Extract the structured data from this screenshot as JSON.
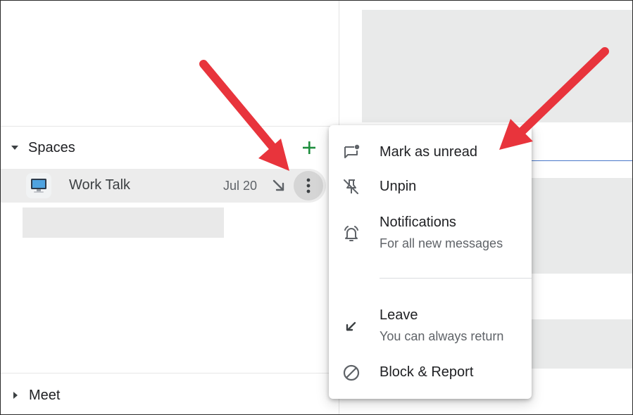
{
  "left_panel": {
    "spaces_label": "Spaces",
    "meet_label": "Meet",
    "space_row": {
      "avatar_emoji": "🖥️",
      "name": "Work Talk",
      "date": "Jul 20"
    }
  },
  "menu": {
    "items": [
      {
        "title": "Mark as unread",
        "icon": "mark-unread-icon"
      },
      {
        "title": "Unpin",
        "icon": "unpin-icon"
      },
      {
        "title": "Notifications",
        "subtitle": "For all new messages",
        "icon": "notification-bell-icon"
      },
      {
        "title": "Leave",
        "subtitle": "You can always return",
        "icon": "leave-arrow-icon"
      },
      {
        "title": "Block & Report",
        "icon": "block-icon"
      }
    ]
  },
  "colors": {
    "accent_green": "#1e8e3e",
    "annotation_red": "#e8343c",
    "row_highlight": "#ececec"
  }
}
